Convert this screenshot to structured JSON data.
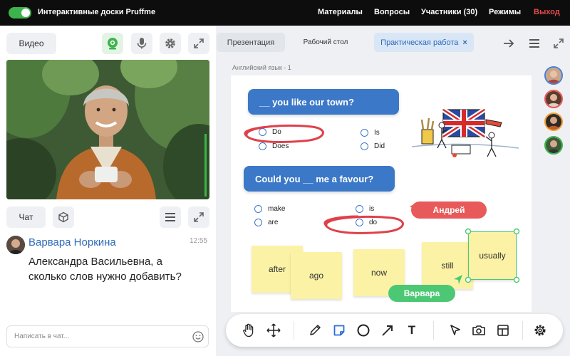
{
  "topbar": {
    "app_title": "Интерактивные доски Pruffme",
    "nav": [
      "Материалы",
      "Вопросы",
      "Участники (30)",
      "Режимы"
    ],
    "exit": "Выход",
    "toggle_on": true,
    "exit_color": "#e84a4a"
  },
  "left": {
    "video_button": "Видео",
    "chat_button": "Чат",
    "chat": {
      "author": "Варвара Норкина",
      "time": "12:55",
      "text": "Александра Васильевна, а сколько слов нужно добавить?",
      "input_placeholder": "Написать в чат..."
    }
  },
  "tabs": {
    "presentation": "Презентация",
    "desktop": "Рабочий стол",
    "practice": "Практическая работа",
    "close": "×"
  },
  "board": {
    "label": "Английский язык - 1",
    "q1": {
      "text": "__ you like our town?",
      "options": [
        "Do",
        "Does",
        "Is",
        "Did"
      ],
      "circled": "Do"
    },
    "q2": {
      "text": "Could you __ me a favour?",
      "options": [
        "make",
        "are",
        "is",
        "do"
      ],
      "circled": "do"
    },
    "stickies": [
      "after",
      "ago",
      "now",
      "still",
      "usually"
    ],
    "cursors": [
      {
        "name": "Андрей",
        "color": "#e85a5a"
      },
      {
        "name": "Варвара",
        "color": "#4cc874"
      }
    ]
  },
  "participants": [
    {
      "ring": "#4a7fd1"
    },
    {
      "ring": "#e85a5a"
    },
    {
      "ring": "#f0a030"
    },
    {
      "ring": "#3cb44b"
    }
  ],
  "toolbar": {
    "icons": [
      "hand-icon",
      "move-icon",
      "pencil-icon",
      "sticky-note-icon",
      "circle-icon",
      "arrow-icon",
      "text-icon",
      "pointer-icon",
      "camera-icon",
      "layout-icon",
      "settings-icon"
    ],
    "active": "sticky-note-icon",
    "text_tool": "T"
  },
  "colors": {
    "accent": "#3c78c8",
    "green": "#3cb44b",
    "red_annotation": "#e0404a",
    "sticky": "#fbf2a6"
  }
}
